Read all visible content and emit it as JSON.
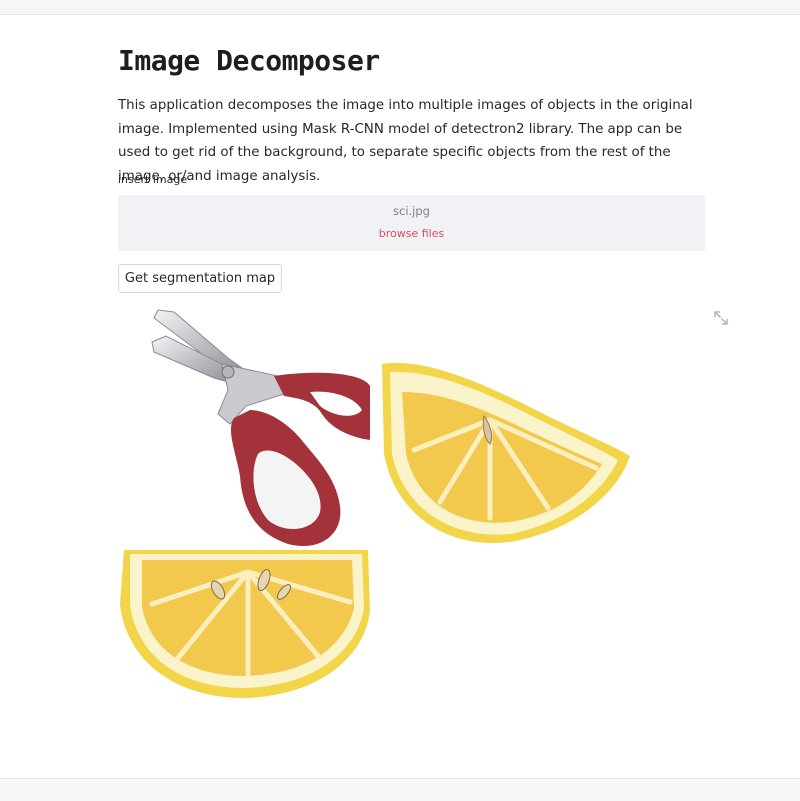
{
  "page": {
    "title": "Image Decomposer",
    "description": "This application decomposes the image into multiple images of objects in the original image. Implemented using Mask R-CNN model of detectron2 library. The app can be used to get rid of the background, to separate specific objects from the rest of the image, or/and image analysis."
  },
  "uploader": {
    "label": "insert image",
    "filename": "sci.jpg",
    "browse_label": "browse files"
  },
  "actions": {
    "segment_label": "Get segmentation map"
  },
  "colors": {
    "accent": "#e0485f",
    "dropzone_bg": "#f0f2f6",
    "scissors_handle": "#a3323a",
    "lemon_peel": "#f3d54a"
  },
  "icons": {
    "expand": "expand-arrows-icon"
  }
}
